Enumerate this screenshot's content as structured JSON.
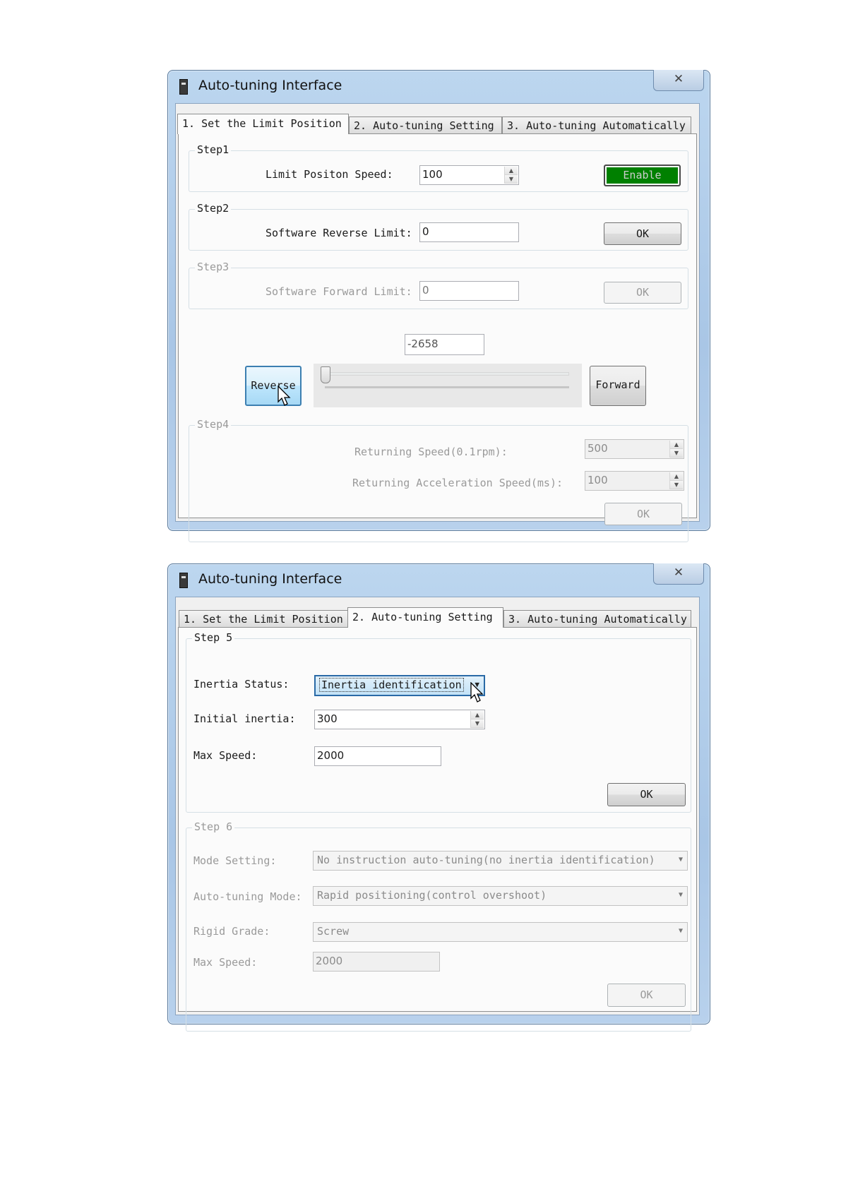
{
  "window1": {
    "title": "Auto-tuning Interface",
    "close_glyph": "✕",
    "tabs": [
      "1. Set the Limit Position",
      "2. Auto-tuning Setting",
      "3. Auto-tuning Automatically"
    ],
    "step1": {
      "title": "Step1",
      "label": "Limit Positon Speed:",
      "value": "100",
      "button": "Enable"
    },
    "step2": {
      "title": "Step2",
      "label": "Software Reverse Limit:",
      "value": "0",
      "button": "OK"
    },
    "step3": {
      "title": "Step3",
      "label": "Software Forward Limit:",
      "value": "0",
      "button": "OK"
    },
    "position": "-2658",
    "reverse_button": "Reverse",
    "forward_button": "Forward",
    "step4": {
      "title": "Step4",
      "speed_label": "Returning Speed(0.1rpm):",
      "speed_value": "500",
      "accel_label": "Returning Acceleration Speed(ms):",
      "accel_value": "100",
      "button": "OK"
    }
  },
  "window2": {
    "title": "Auto-tuning Interface",
    "close_glyph": "✕",
    "tabs": [
      "1. Set the Limit Position",
      "2. Auto-tuning Setting",
      "3. Auto-tuning Automatically"
    ],
    "step5": {
      "title": "Step 5",
      "inertia_status_label": "Inertia Status:",
      "inertia_status_value": "Inertia identification",
      "initial_inertia_label": "Initial inertia:",
      "initial_inertia_value": "300",
      "max_speed_label": "Max Speed:",
      "max_speed_value": "2000",
      "button": "OK"
    },
    "step6": {
      "title": "Step 6",
      "mode_label": "Mode Setting:",
      "mode_value": "No instruction auto-tuning(no inertia identification)",
      "autotuning_mode_label": "Auto-tuning Mode:",
      "autotuning_mode_value": "Rapid positioning(control overshoot)",
      "rigid_label": "Rigid Grade:",
      "rigid_value": "Screw",
      "max_speed_label": "Max Speed:",
      "max_speed_value": "2000",
      "button": "OK"
    }
  },
  "colors": {
    "enable_green": "#008000",
    "titlebar_blue": "#a9c6e6",
    "disabled_text": "#9a9a9a"
  }
}
